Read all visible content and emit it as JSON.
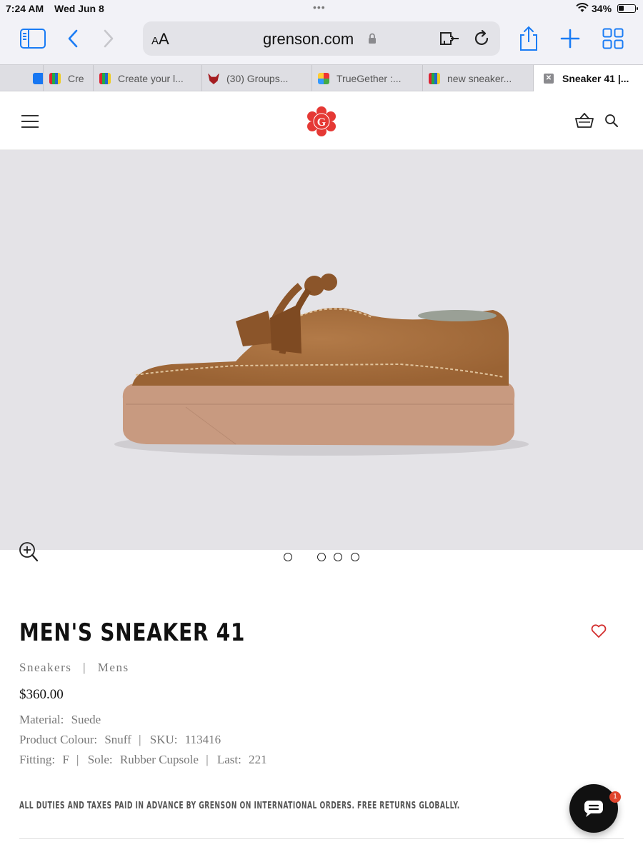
{
  "status_bar": {
    "time": "7:24 AM",
    "date": "Wed Jun 8",
    "battery_pct": "34%",
    "battery_level": 0.34
  },
  "browser": {
    "aa_small": "A",
    "aa_large": "A",
    "url": "grenson.com",
    "tabs": [
      {
        "label": "Cre",
        "favicon": "bag-icon"
      },
      {
        "label": "Create your l...",
        "favicon": "bag-icon"
      },
      {
        "label": "(30) Groups...",
        "favicon": "fox-icon"
      },
      {
        "label": "TrueGether :...",
        "favicon": "truegether-icon"
      },
      {
        "label": "new sneaker...",
        "favicon": "bag-icon"
      },
      {
        "label": "Sneaker 41 |...",
        "favicon": "close-icon",
        "active": true
      }
    ]
  },
  "site": {
    "logo_letter": "G",
    "accent_color": "#e53935"
  },
  "product": {
    "title": "MEN'S SNEAKER 41",
    "category": "Sneakers",
    "category_sep": "|",
    "gender": "Mens",
    "price": "$360.00",
    "material_label": "Material:",
    "material": "Suede",
    "colour_label": "Product Colour:",
    "colour": "Snuff",
    "sku_label": "SKU:",
    "sku": "113416",
    "fitting_label": "Fitting:",
    "fitting": "F",
    "sole_label": "Sole:",
    "sole": "Rubber Cupsole",
    "last_label": "Last:",
    "last": "221",
    "pipe": "|",
    "duties_notice": "ALL DUTIES AND TAXES PAID IN ADVANCE BY GRENSON ON INTERNATIONAL ORDERS. FREE RETURNS GLOBALLY.",
    "image_count": 4,
    "active_image": 1
  },
  "chat": {
    "unread": "1"
  }
}
